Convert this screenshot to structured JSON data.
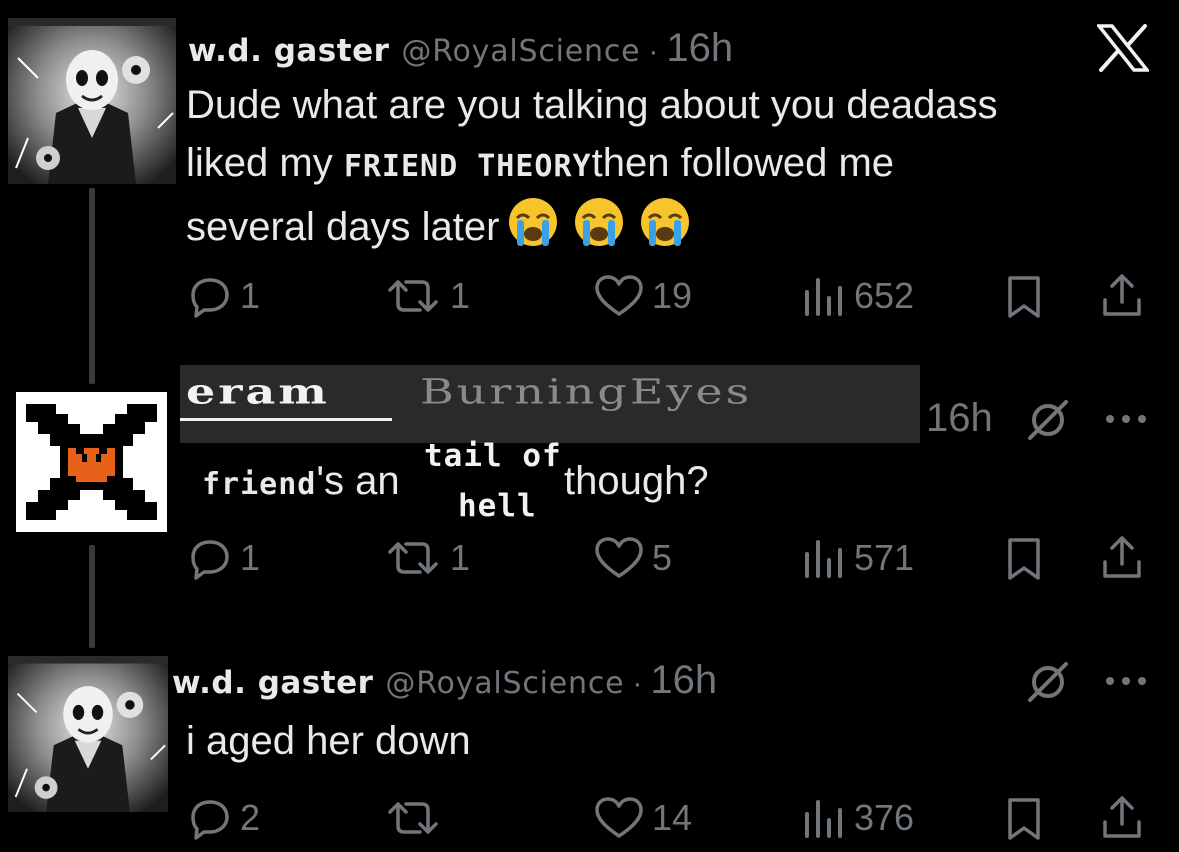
{
  "app": {
    "logo": "x-logo"
  },
  "tweets": [
    {
      "display_name": "w.d. gaster",
      "handle": "@RoyalScience",
      "separator": "·",
      "time": "16h",
      "text_parts": {
        "line1": "Dude what are you talking about you deadass",
        "line2_pre": "liked my ",
        "line2_styled": "FRIEND THEORY",
        "line2_post": "then followed me",
        "line3": "several days later"
      },
      "emojis": [
        "loudly-crying-face",
        "loudly-crying-face",
        "loudly-crying-face"
      ],
      "actions": {
        "replies": "1",
        "reposts": "1",
        "likes": "19",
        "views": "652"
      }
    },
    {
      "display_name": "eram",
      "handle": "BurningEyes",
      "time": "16h",
      "text_parts": {
        "styled_word": "friend",
        "mid": "'s an",
        "tail_top": "tail of",
        "tail_bottom": "hell",
        "end": "though?"
      },
      "actions": {
        "replies": "1",
        "reposts": "1",
        "likes": "5",
        "views": "571"
      }
    },
    {
      "display_name": "w.d. gaster",
      "handle": "@RoyalScience",
      "separator": "·",
      "time": "16h",
      "text": "i aged her down",
      "actions": {
        "replies": "2",
        "reposts": "",
        "likes": "14",
        "views": "376"
      }
    }
  ],
  "icons": {
    "reply": "reply-icon",
    "repost": "repost-icon",
    "like": "heart-icon",
    "views": "views-icon",
    "bookmark": "bookmark-icon",
    "share": "share-icon",
    "grok": "grok-icon",
    "more": "more-icon"
  },
  "colors": {
    "background": "#000000",
    "text": "#e7e9ea",
    "muted": "#71767b",
    "avatar_accent": "#e8611a"
  }
}
